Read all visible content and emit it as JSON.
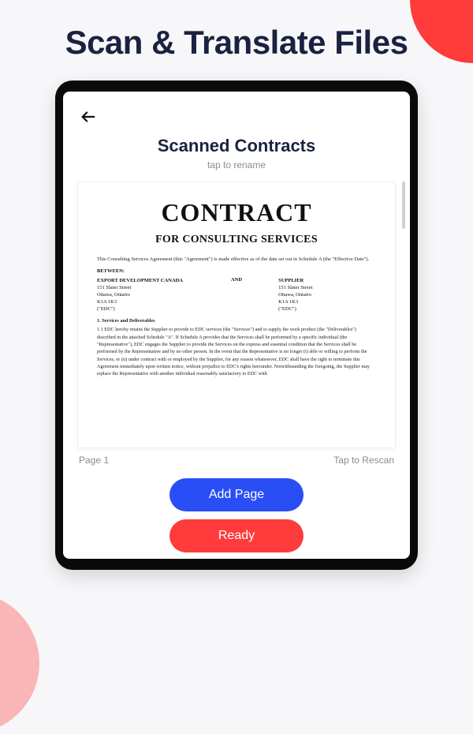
{
  "hero": {
    "title": "Scan & Translate Files"
  },
  "screen": {
    "title": "Scanned Contracts",
    "subtitle": "tap to rename",
    "page_label": "Page 1",
    "rescan_label": "Tap to Rescan"
  },
  "document": {
    "heading": "CONTRACT",
    "subheading": "FOR CONSULTING SERVICES",
    "intro": "This Consulting Services Agreement (this \"Agreement\") is made effective as of the date set out in Schedule A (the \"Effective Date\").",
    "between_label": "BETWEEN:",
    "and_label": "AND",
    "party_a": {
      "name": "EXPORT DEVELOPMENT CANADA",
      "line1": "151 Slater Street",
      "line2": "Ottawa, Ontario",
      "line3": "K1A 1K3",
      "line4": "(\"EDC\")"
    },
    "party_b": {
      "name": "SUPPLIER",
      "line1": "151 Slater Street",
      "line2": "Ottawa, Ontario",
      "line3": "K1A 1K3",
      "line4": "(\"EDC\")"
    },
    "section1_title": "1. Services and Deliverables",
    "section1_body": "1.1 EDC hereby retains the Supplier to provide to EDC services (the \"Services\") and to supply the work product (the \"Deliverables\") described in the attached Schedule \"A\". If Schedule A provides that the Services shall be performed by a specific individual (the \"Representative\"), EDC engages the Supplier to provide the Services on the express and essential condition that the Services shall be performed by the Representative and by no other person. In the event that the Representative is no longer (i) able or willing to perform the Services, or (ii) under contract with or employed by the Supplier, for any reason whatsoever, EDC shall have the right to terminate this Agreement immediately upon written notice, without prejudice to EDC's rights hereunder. Notwithstanding the foregoing, the Supplier may replace the Representative with another individual reasonably satisfactory to EDC with"
  },
  "actions": {
    "add_page": "Add Page",
    "ready": "Ready"
  }
}
